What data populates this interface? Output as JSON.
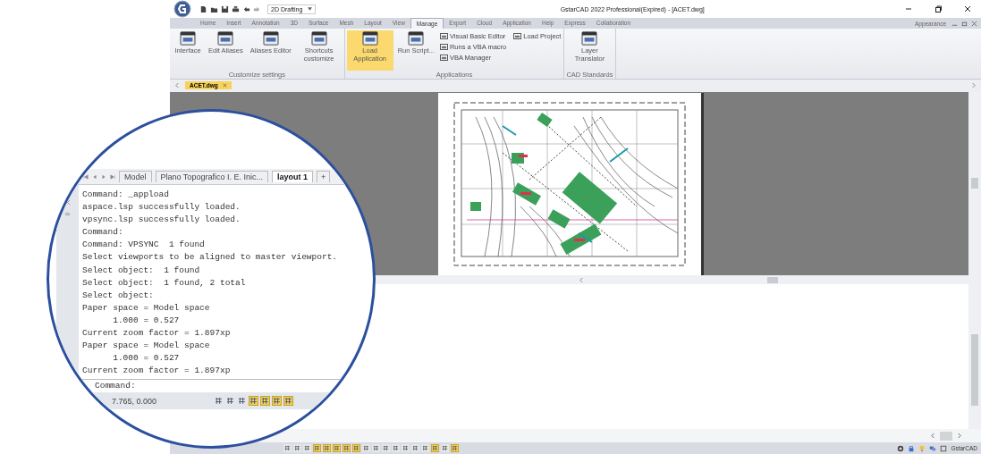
{
  "title_bar": {
    "workspace": "2D Drafting",
    "title": "GstarCAD 2022 Professional(Expired) - [ACET.dwg]"
  },
  "ribbon_tabs": [
    {
      "label": "Home",
      "selected": false
    },
    {
      "label": "Insert",
      "selected": false
    },
    {
      "label": "Annotation",
      "selected": false
    },
    {
      "label": "3D",
      "selected": false
    },
    {
      "label": "Surface",
      "selected": false
    },
    {
      "label": "Mesh",
      "selected": false
    },
    {
      "label": "Layout",
      "selected": false
    },
    {
      "label": "View",
      "selected": false
    },
    {
      "label": "Manage",
      "selected": true
    },
    {
      "label": "Export",
      "selected": false
    },
    {
      "label": "Cloud",
      "selected": false
    },
    {
      "label": "Application",
      "selected": false
    },
    {
      "label": "Help",
      "selected": false
    },
    {
      "label": "Express",
      "selected": false
    },
    {
      "label": "Collaboration",
      "selected": false
    }
  ],
  "appearance": "Appearance",
  "ribbon_groups": [
    {
      "title": "Customize settings",
      "tools": [
        {
          "kind": "large",
          "label": "Interface",
          "selected": false
        },
        {
          "kind": "large",
          "label": "Edit Aliases",
          "selected": false
        },
        {
          "kind": "large",
          "label": "Aliases Editor",
          "selected": false
        },
        {
          "kind": "large",
          "label": "Shortcuts customize",
          "selected": false
        }
      ]
    },
    {
      "title": "Applications",
      "tools": [
        {
          "kind": "large",
          "label": "Load Application",
          "selected": true
        },
        {
          "kind": "large",
          "label": "Run Script...",
          "selected": false
        },
        {
          "kind": "small",
          "label": "Visual Basic Editor",
          "selected": false
        },
        {
          "kind": "small",
          "label": "Runs a VBA macro",
          "selected": false
        },
        {
          "kind": "small",
          "label": "VBA Manager",
          "selected": false
        },
        {
          "kind": "small",
          "label": "Load Project",
          "selected": false
        }
      ]
    },
    {
      "title": "CAD Standards",
      "tools": [
        {
          "kind": "large",
          "label": "Layer Translator",
          "selected": false
        }
      ]
    }
  ],
  "document_tabs": [
    {
      "label": "ACET.dwg",
      "selected": true
    }
  ],
  "status_bar": {
    "toggles": [
      {
        "on": false
      },
      {
        "on": false
      },
      {
        "on": false
      },
      {
        "on": true
      },
      {
        "on": true
      },
      {
        "on": true
      },
      {
        "on": true
      },
      {
        "on": true
      },
      {
        "on": false
      },
      {
        "on": false
      },
      {
        "on": false
      },
      {
        "on": false
      },
      {
        "on": false
      },
      {
        "on": false
      },
      {
        "on": false
      },
      {
        "on": true
      },
      {
        "on": false
      },
      {
        "on": true
      }
    ],
    "brand": "GstarCAD"
  },
  "magnifier": {
    "layout_tabs": [
      {
        "label": "Model",
        "kind": "tab",
        "selected": false
      },
      {
        "label": "Plano Topografico I. E. Inic...",
        "kind": "tab",
        "selected": false
      },
      {
        "label": "layout 1",
        "kind": "tab",
        "selected": true
      },
      {
        "label": "+",
        "kind": "add",
        "selected": false
      }
    ],
    "history": [
      "Command: _appload",
      "aspace.lsp successfully loaded.",
      "vpsync.lsp successfully loaded.",
      "Command:",
      "Command: VPSYNC  1 found",
      "Select viewports to be aligned to master viewport.",
      "Select object:  1 found",
      "Select object:  1 found, 2 total",
      "Select object:",
      "Paper space = Model space",
      "      1.000 = 0.527",
      "Current zoom factor = 1.897xp",
      "Paper space = Model space",
      "      1.000 = 0.527",
      "Current zoom factor = 1.897xp"
    ],
    "prompt": "Command:",
    "coordinates": "7.765, 0.000",
    "toggles": [
      {
        "on": false
      },
      {
        "on": false
      },
      {
        "on": false
      },
      {
        "on": true
      },
      {
        "on": true
      },
      {
        "on": true
      },
      {
        "on": true
      }
    ]
  }
}
